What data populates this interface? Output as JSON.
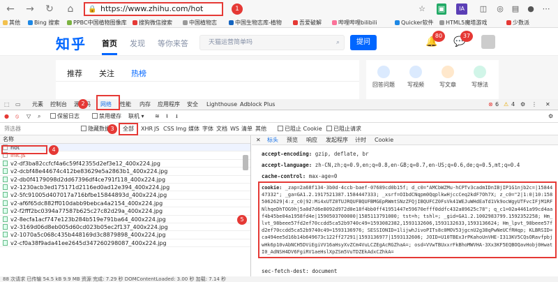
{
  "browser": {
    "url": "https://www.zhihu.com/hot",
    "callouts": [
      "1",
      "2",
      "3",
      "4",
      "5"
    ],
    "extension_badges": [
      "80",
      "37"
    ]
  },
  "bookmarks": [
    "其他",
    "Bing 搜索",
    "PPBC中国植物图像库",
    "搜狗微信搜索",
    "中国植物志",
    "中国生物志库-植物",
    "吾爱破解",
    "哔哩哔哩bilibili",
    "Quicker软件",
    "HTML5魔塔游戏",
    "少数派"
  ],
  "zhihu": {
    "logo": "知乎",
    "nav": [
      "首页",
      "发现",
      "等你来答"
    ],
    "search_placeholder": "天猫运营简单吗",
    "ask_button": "提问",
    "notif_badge": "80",
    "msg_badge": "37",
    "feed_tabs": [
      "推荐",
      "关注",
      "热榜"
    ],
    "quick_actions": [
      "回答问题",
      "写视频",
      "写文章",
      "写想法"
    ]
  },
  "devtools": {
    "tabs": [
      "元素",
      "控制台",
      "源代码",
      "网络",
      "性能",
      "内存",
      "应用程序",
      "安全",
      "Lighthouse",
      "Adblock Plus"
    ],
    "error_count": "6",
    "warn_count": "4",
    "toolbar": {
      "preserve_log": "保留日志",
      "disable_cache": "禁用缓存",
      "online": "联机"
    },
    "filter": {
      "placeholder": "筛选器",
      "hide_data_urls": "隐藏数据",
      "types": [
        "全部",
        "XHR",
        "JS",
        "CSS",
        "Img",
        "媒体",
        "字体",
        "文档",
        "WS",
        "清单",
        "其他"
      ],
      "blocked_cookies": "已阻止 Cookie",
      "blocked_requests": "已阻止请求"
    },
    "list_header": "名称",
    "requests": [
      "hot",
      "init.js",
      "v2-df3ba82ccfcf4a6c59f42355d2ef3e12_400x224.jpg",
      "v2-dcbf48e44674c412be83629e5a2863b1_400x224.jpg",
      "v2-db0f4179098d2dd67396df4ce791f118_400x224.jpg",
      "v2-1230acb3ed175171d2116ed0ad12e394_400x224.jpg",
      "v2-5fc91005d407017a716bfbe15844893d_400x224.jpg",
      "v2-af6f65dc882ff010dabb9bebca4a2154_400x224.jpg",
      "v2-f2fff2bc0394a77587b625c27c82d29a_400x224.jpg",
      "v2-8ecfa1acf747e123b284b519e791ba64_400x224.jpg",
      "v2-3169d06d8eb005d60cd023b05ec2f137_400x224.jpg",
      "v2-1070a5c068c435b448169d3c8879898_400x224.jpg",
      "v2-cf0a38f9ada41ee2645d347260298087_400x224.jpg"
    ],
    "status": "88 次请求  已传输 54.5 kB  9.9 MB 资源  完成: 7.29 秒  DOMContentLoaded: 3.00 秒  加载: 7.14 秒",
    "detail_tabs": [
      "标头",
      "预览",
      "响应",
      "发起程序",
      "计时",
      "Cookie"
    ],
    "headers": [
      {
        "name": "accept-encoding:",
        "value": "gzip, deflate, br"
      },
      {
        "name": "accept-language:",
        "value": "zh-CN,zh;q=0.9,en;q=0.8,en-GB;q=0.7,en-US;q=0.6,de;q=0.5,mt;q=0.4"
      },
      {
        "name": "cache-control:",
        "value": "max-age=0"
      }
    ],
    "cookie_name": "cookie:",
    "cookie_value": "_zap=2a68f134-3b0d-4ccb-baef-07689cd0b15f; d_c0=\"AMCbWZMu-hCPTv3cadmIDnIBjIP1G1njb2c=|1584447332\"; _ga=GA1.2.1917521387.1584447333; _xsrf=OIbdCNqpm0QqplkwHjccCeq2kdF7Oh7X; z_c0=\"2|1:0|10:1585062629|4:z_c0|92:Mi4xUTZ0TUJRQUFBQUFBMGEpRWmtSNzZFQjIBQUFCZ0FsVk41WEJuWHdEaTd1Vk9ocWgyUTFvcIFjM1RFNlhqeDhTOG9h|5a0d7d6e8092d972d0e18f4bb0ff41951447e59670efff0ddfc432a89625c78\"; q_c1=02a4461a99cd4aaf4b45be04a1958fd4e|1590503700000|1585113791000; tst=h; tshl=; _gid=GA1.2.1002983799.1592352258; Hm_lvt_98beee57fd2ef70ccdd5ca52b9740c49=1593082382,1593132606,1593132633,1593136624; Hm_lpvt_98beee57fd2ef70ccdd5ca52b9740c49=1593136976; SESSIONID=1lijwhJivoPITs8c0MOV53jgcnU2g38qPwNeUCfRHqp; KLBRSID=ca494ee5d16b14b649673c122ff27291|1593136977|1593132606; JOID=U10TBEx3rPKahoUnVHE-I313KV5CQsORavfpbjwHk6p10vAbNCH5DViEgiVV16aHsyXvZCm4VuLCZEgAcRGZhaA=; osd=VVwTBUxxrFkBhoMWVHA-3Xx3KF5EQBOQavHobj0HwatI0_AdNSH4DV6FgiRV1aeHslXpZSm5VuTDZEkAdxCZhkA=",
    "last_header": "sec-fetch-dest: document"
  },
  "colors": {
    "accent": "#0066ff",
    "annotation": "#e53935"
  }
}
